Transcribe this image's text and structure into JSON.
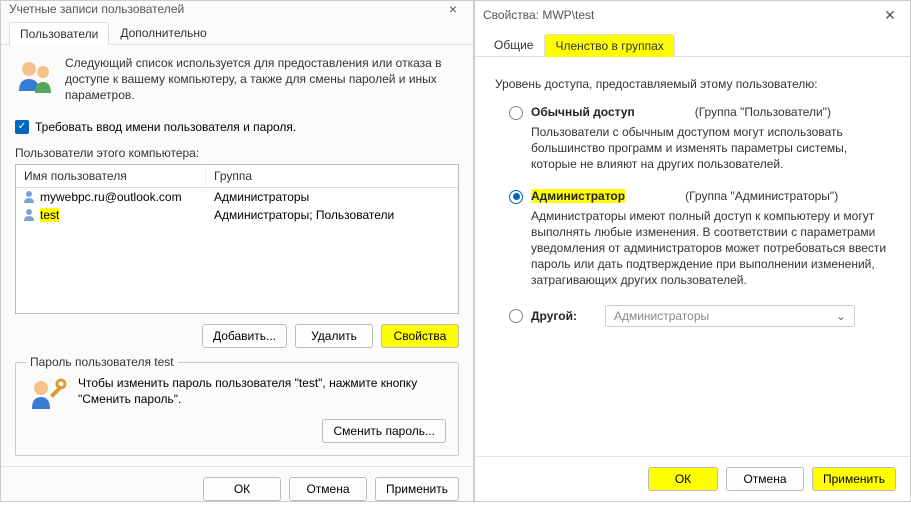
{
  "left": {
    "title": "Учетные записи пользователей",
    "tabs": {
      "users": "Пользователи",
      "advanced": "Дополнительно"
    },
    "intro": "Следующий список используется для предоставления или отказа в доступе к вашему компьютеру, а также для смены паролей и иных параметров.",
    "require_login": "Требовать ввод имени пользователя и пароля.",
    "users_of_pc": "Пользователи этого компьютера:",
    "th_user": "Имя пользователя",
    "th_group": "Группа",
    "rows": [
      {
        "name": "mywebpc.ru@outlook.com",
        "group": "Администраторы"
      },
      {
        "name": "test",
        "group": "Администраторы; Пользователи"
      }
    ],
    "btn_add": "Добавить...",
    "btn_remove": "Удалить",
    "btn_props": "Свойства",
    "pw_legend": "Пароль пользователя test",
    "pw_text": "Чтобы изменить пароль пользователя \"test\", нажмите кнопку \"Сменить пароль\".",
    "btn_change_pw": "Сменить пароль...",
    "btn_ok": "ОК",
    "btn_cancel": "Отмена",
    "btn_apply": "Применить"
  },
  "right": {
    "title": "Свойства: MWP\\test",
    "tabs": {
      "general": "Общие",
      "membership": "Членство в группах"
    },
    "intro": "Уровень доступа, предоставляемый этому пользователю:",
    "opt_user": "Обычный доступ",
    "opt_user_hint": "(Группа \"Пользователи\")",
    "opt_user_desc": "Пользователи с обычным доступом могут использовать большинство программ и изменять параметры системы, которые не влияют на других пользователей.",
    "opt_admin": "Администратор",
    "opt_admin_hint": "(Группа \"Администраторы\")",
    "opt_admin_desc": "Администраторы имеют полный доступ к компьютеру и могут выполнять любые изменения. В соответствии с параметрами уведомления от администраторов может потребоваться ввести пароль или дать подтверждение при выполнении изменений, затрагивающих других пользователей.",
    "opt_other": "Другой:",
    "combo_value": "Администраторы",
    "btn_ok": "ОК",
    "btn_cancel": "Отмена",
    "btn_apply": "Применить"
  }
}
